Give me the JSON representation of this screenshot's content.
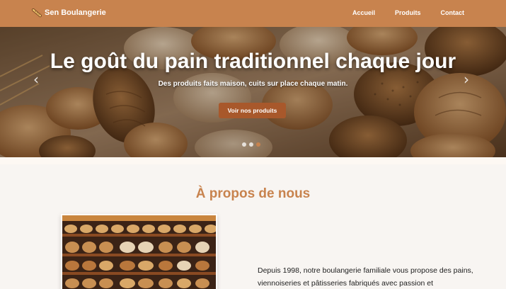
{
  "navbar": {
    "brand": "Sen Boulangerie",
    "links": [
      "Accueil",
      "Produits",
      "Contact"
    ],
    "color": "#c8834e"
  },
  "hero": {
    "title": "Le goût du pain traditionnel chaque jour",
    "subtitle": "Des produits faits maison, cuits sur place chaque matin.",
    "button": "Voir nos produits",
    "prev": "‹",
    "next": "›",
    "slides": 3,
    "active_slide": 3
  },
  "about": {
    "title": "À propos de nous",
    "text": "Depuis 1998, notre boulangerie familiale vous propose des pains, viennoiseries et pâtisseries fabriqués avec passion et"
  }
}
